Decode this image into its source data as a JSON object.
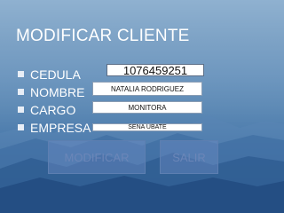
{
  "title": "MODIFICAR CLIENTE",
  "fields": [
    {
      "label": "CEDULA",
      "value": "1076459251"
    },
    {
      "label": "NOMBRE",
      "value": "NATALIA RODRIGUEZ"
    },
    {
      "label": "CARGO",
      "value": "MONITORA"
    },
    {
      "label": "EMPRESA",
      "value": "SENA UBATE"
    }
  ],
  "buttons": {
    "modify": "MODIFICAR",
    "exit": "SALIR"
  },
  "colors": {
    "sky_top": "#8fb1d0",
    "sky_bottom": "#234d80",
    "text": "#ffffff",
    "button_text": "#6b86b8"
  }
}
